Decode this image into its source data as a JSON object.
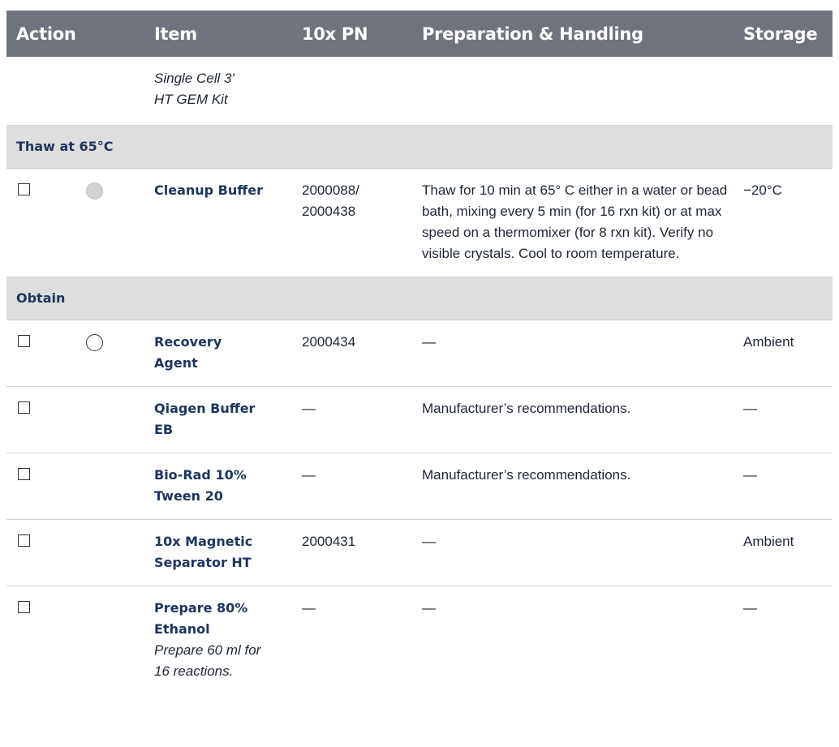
{
  "headers": {
    "action": "Action",
    "item": "Item",
    "pn": "10x PN",
    "prep": "Preparation & Handling",
    "storage": "Storage"
  },
  "kit_row": {
    "item": "Single Cell 3' HT GEM Kit"
  },
  "sections": {
    "thaw": "Thaw at 65°C",
    "obtain": "Obtain"
  },
  "rows": [
    {
      "tube": "gray-tube-icon",
      "item": "Cleanup Buffer",
      "note": "",
      "pn": "2000088/ 2000438",
      "prep": "Thaw for 10 min at 65° C either in a water or bead bath, mixing every 5 min (for 16 rxn kit) or at max speed on a thermomixer (for 8 rxn kit). Verify no visible crystals. Cool to room temperature.",
      "storage": "−20°C"
    },
    {
      "tube": "white-tube-icon",
      "item": "Recovery Agent",
      "note": "",
      "pn": "2000434",
      "prep": "—",
      "storage": "Ambient"
    },
    {
      "item": "Qiagen Buffer EB",
      "note": "",
      "pn": "—",
      "prep": "Manufacturer’s recommendations.",
      "storage": "—"
    },
    {
      "item": "Bio-Rad 10% Tween 20",
      "note": "",
      "pn": "—",
      "prep": "Manufacturer’s recommendations.",
      "storage": "—"
    },
    {
      "item": "10x Magnetic Separator HT",
      "note": "",
      "pn": "2000431",
      "prep": "—",
      "storage": "Ambient"
    },
    {
      "item": "Prepare 80% Ethanol",
      "note": "Prepare 60 ml for 16 reactions.",
      "pn": "—",
      "prep": "—",
      "storage": "—"
    }
  ],
  "colors": {
    "header_bg": "#6f737b",
    "section_bg": "#dedede",
    "item_text": "#1f3560",
    "tube_gray": "#d2d2d2"
  }
}
